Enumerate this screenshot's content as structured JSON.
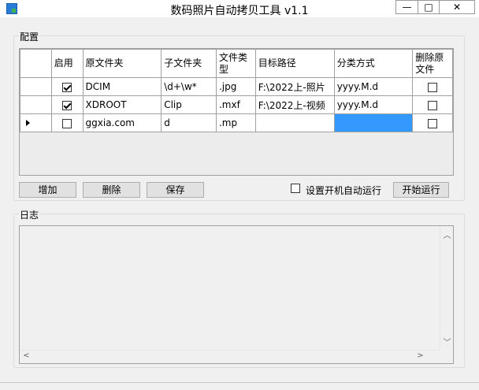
{
  "window": {
    "title": "数码照片自动拷贝工具 v1.1",
    "min_glyph": "—",
    "max_glyph": "□",
    "close_glyph": "✕"
  },
  "config": {
    "label": "配置",
    "columns": [
      "启用",
      "原文件夹",
      "子文件夹",
      "文件类型",
      "目标路径",
      "分类方式",
      "删除原文件"
    ],
    "rows": [
      {
        "enabled": true,
        "source": "DCIM",
        "subfolder": "\\d+\\w*",
        "type": ".jpg",
        "target": "F:\\2022上-照片",
        "classify": "yyyy.M.d",
        "delete": false
      },
      {
        "enabled": true,
        "source": "XDROOT",
        "subfolder": "Clip",
        "type": ".mxf",
        "target": "F:\\2022上-视频",
        "classify": "yyyy.M.d",
        "delete": false
      },
      {
        "enabled": false,
        "source": "ggxia.com",
        "subfolder": "d",
        "type": ".mp",
        "target": "",
        "classify": "",
        "delete": false,
        "current": true
      }
    ]
  },
  "buttons": {
    "add": "增加",
    "delete": "删除",
    "save": "保存",
    "autostart_label": "设置开机自动运行",
    "start": "开始运行"
  },
  "log": {
    "label": "日志"
  },
  "colors": {
    "selected_cell": "#3399ff"
  }
}
